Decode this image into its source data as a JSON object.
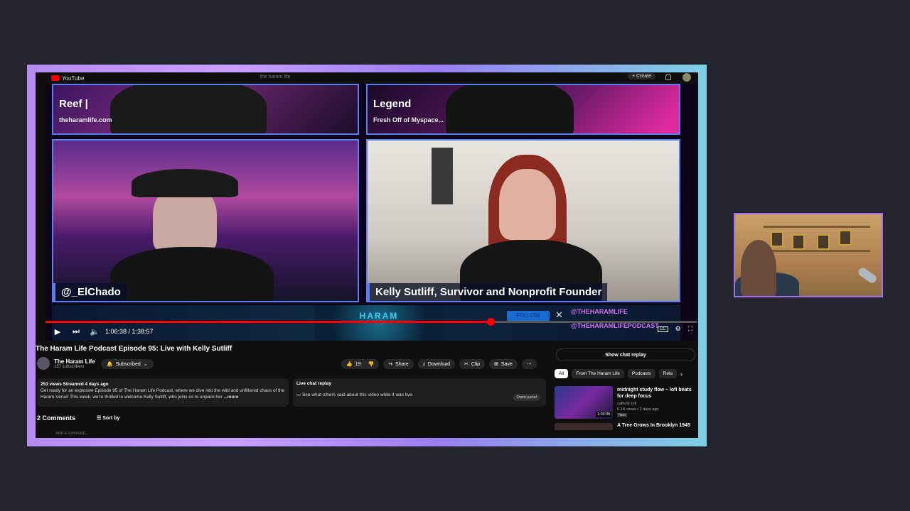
{
  "youtube_header": {
    "logo_text": "YouTube",
    "search_text": "the haram life",
    "create_label": "Create"
  },
  "video": {
    "tiles": {
      "top_left": {
        "title": "Reef |",
        "subtitle": "theharamlife.com"
      },
      "top_right": {
        "title": "Legend",
        "subtitle": "Fresh Off of Myspace..."
      },
      "main_left": {
        "name": "@_ElChado"
      },
      "main_right": {
        "name": "Kelly Sutliff, Survivor and Nonprofit Founder"
      }
    },
    "bottom_bar": {
      "logo_text": "HARAM",
      "follow_label": "FOLLOW",
      "handle_1": "@THEHARAMLIFE",
      "handle_2": "@THEHARAMLIFEPODCAST"
    },
    "progress_fraction": 0.683,
    "time_display": "1:06:38 / 1:38:57"
  },
  "details": {
    "title": "The Haram Life Podcast Episode 95: Live with Kelly Sutliff",
    "channel_name": "The Haram Life",
    "subscribers": "157 subscribers",
    "subscribed_label": "Subscribed",
    "like_count": "19",
    "share_label": "Share",
    "download_label": "Download",
    "clip_label": "Clip",
    "save_label": "Save",
    "description_meta": "253 views  Streamed 4 days ago",
    "description_text": "Get ready for an explosive Episode 95 of The Haram Life Podcast, where we dive into the wild and unfiltered chaos of the Haram-Verse! This week, we're thrilled to welcome Kelly Sutliff, who joins us to unpack her",
    "more_label": "...more",
    "live_chat_title": "Live chat replay",
    "live_chat_text": "See what others said about this video while it was live.",
    "open_panel_label": "Open panel",
    "comments_label": "2 Comments",
    "sort_label": "Sort by",
    "add_comment_placeholder": "Add a comment..."
  },
  "sidebar": {
    "show_chat_replay": "Show chat replay",
    "chips": [
      "All",
      "From The Haram Life",
      "Podcasts",
      "Rela"
    ],
    "rec1": {
      "title": "midnight study flow – lofi beats for deep focus",
      "channel": "catholic lofi",
      "views": "5.1K views • 2 days ago",
      "badge": "New",
      "duration": "1:03:35"
    },
    "rec2": {
      "title": "A Tree Grows In Brooklyn 1945"
    }
  },
  "colors": {
    "accent_red": "#ff0000",
    "frame_purple": "#b48cf0",
    "tile_border": "#5a7ef0",
    "handle_pink": "#d070f0"
  },
  "icons": [
    "play-icon",
    "next-icon",
    "volume-icon",
    "settings-icon",
    "exit-fullscreen-icon",
    "like-icon",
    "dislike-icon",
    "share-icon",
    "download-icon",
    "clip-icon",
    "save-icon",
    "bell-icon",
    "more-icon"
  ]
}
